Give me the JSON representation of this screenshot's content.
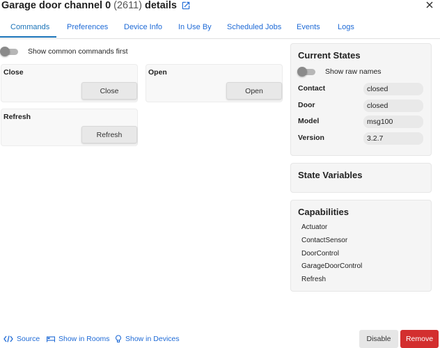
{
  "header": {
    "title": "Garage door channel 0",
    "device_id": "(2611)",
    "title_suffix": "details",
    "link_icon": "external-link-icon",
    "close_icon": "close-icon"
  },
  "tabs": [
    "Commands",
    "Preferences",
    "Device Info",
    "In Use By",
    "Scheduled Jobs",
    "Events",
    "Logs"
  ],
  "active_tab": "Commands",
  "commands": {
    "toggle_label": "Show common commands first",
    "toggle_on": false,
    "items": [
      {
        "name": "Close",
        "button": "Close"
      },
      {
        "name": "Open",
        "button": "Open"
      },
      {
        "name": "Refresh",
        "button": "Refresh"
      }
    ]
  },
  "current_states": {
    "title": "Current States",
    "raw_names_label": "Show raw names",
    "raw_names_on": false,
    "rows": [
      {
        "key": "Contact",
        "value": "closed"
      },
      {
        "key": "Door",
        "value": "closed"
      },
      {
        "key": "Model",
        "value": "msg100"
      },
      {
        "key": "Version",
        "value": "3.2.7"
      }
    ]
  },
  "state_variables": {
    "title": "State Variables"
  },
  "capabilities": {
    "title": "Capabilities",
    "items": [
      "Actuator",
      "ContactSensor",
      "DoorControl",
      "GarageDoorControl",
      "Refresh"
    ]
  },
  "footer": {
    "source": "Source",
    "rooms": "Show in Rooms",
    "devices": "Show in Devices",
    "disable": "Disable",
    "remove": "Remove"
  },
  "colors": {
    "accent": "#1a73b8",
    "link": "#1e6ad6",
    "danger": "#d32f2f"
  }
}
